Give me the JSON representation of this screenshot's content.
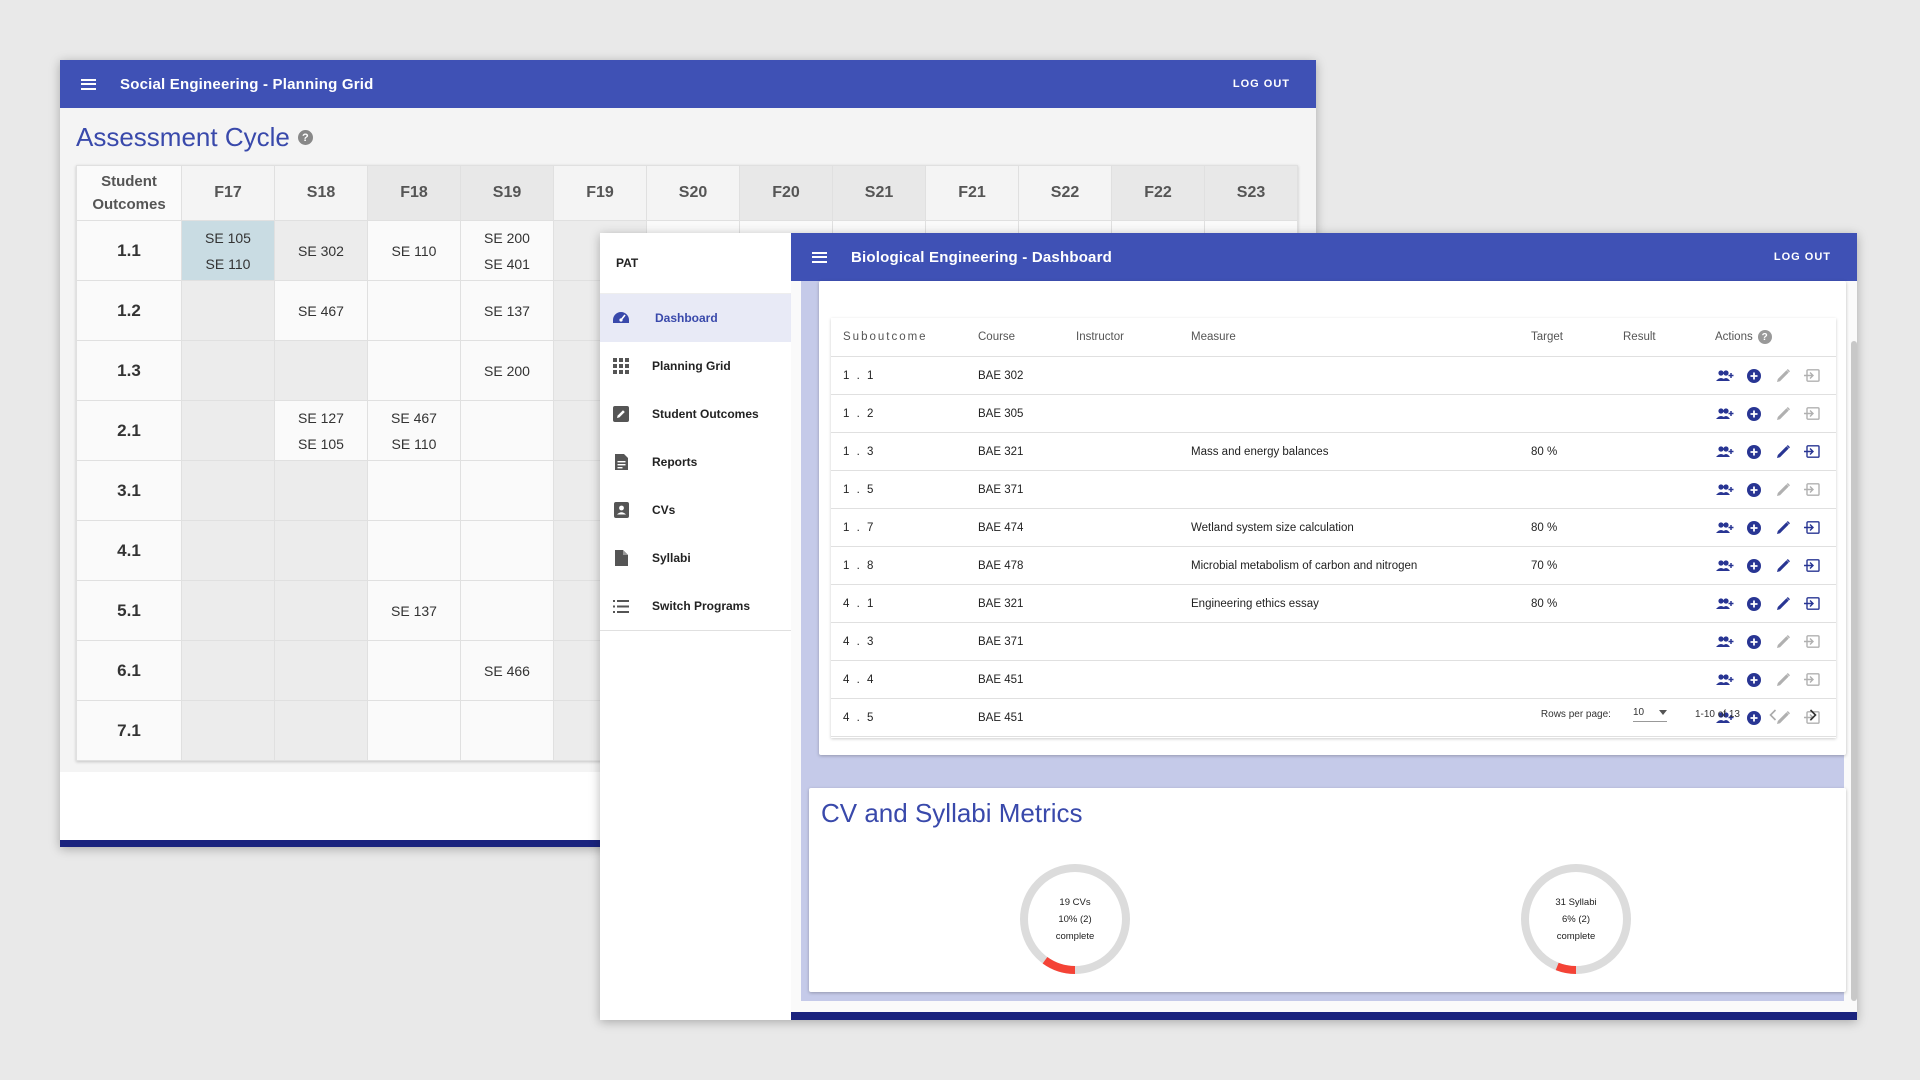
{
  "back_window": {
    "app_title": "Social Engineering - Planning Grid",
    "logout": "LOG OUT",
    "page_title": "Assessment Cycle",
    "help": "?",
    "grid": {
      "outcomes_header": [
        "Student",
        "Outcomes"
      ],
      "terms": [
        "F17",
        "S18",
        "F18",
        "S19",
        "F19",
        "S20",
        "F20",
        "S21",
        "F21",
        "S22",
        "F22",
        "S23"
      ],
      "rows": [
        {
          "outcome": "1.1",
          "cells": [
            [
              "SE 105",
              "SE 110"
            ],
            [
              "SE 302"
            ],
            [
              "SE 110"
            ],
            [
              "SE 200",
              "SE 401"
            ],
            [],
            [],
            [],
            [],
            [],
            [],
            [],
            []
          ]
        },
        {
          "outcome": "1.2",
          "cells": [
            [],
            [
              "SE 467"
            ],
            [],
            [
              "SE 137"
            ],
            [],
            [],
            [],
            [],
            [],
            [],
            [],
            []
          ]
        },
        {
          "outcome": "1.3",
          "cells": [
            [],
            [],
            [],
            [
              "SE 200"
            ],
            [],
            [],
            [],
            [],
            [],
            [],
            [],
            []
          ]
        },
        {
          "outcome": "2.1",
          "cells": [
            [],
            [
              "SE 127",
              "SE 105"
            ],
            [
              "SE 467",
              "SE 110"
            ],
            [],
            [],
            [],
            [],
            [],
            [],
            [],
            [],
            []
          ]
        },
        {
          "outcome": "3.1",
          "cells": [
            [],
            [],
            [],
            [],
            [],
            [],
            [],
            [],
            [],
            [],
            [],
            []
          ]
        },
        {
          "outcome": "4.1",
          "cells": [
            [],
            [],
            [],
            [],
            [],
            [],
            [],
            [],
            [],
            [],
            [],
            []
          ]
        },
        {
          "outcome": "5.1",
          "cells": [
            [],
            [],
            [
              "SE 137"
            ],
            [],
            [],
            [],
            [],
            [],
            [],
            [],
            [],
            []
          ]
        },
        {
          "outcome": "6.1",
          "cells": [
            [],
            [],
            [],
            [
              "SE 466"
            ],
            [],
            [],
            [],
            [],
            [],
            [],
            [],
            []
          ]
        },
        {
          "outcome": "7.1",
          "cells": [
            [],
            [],
            [],
            [],
            [],
            [],
            [],
            [],
            [],
            [],
            [],
            []
          ]
        }
      ]
    }
  },
  "front_window": {
    "drawer": {
      "brand": "PAT",
      "items": [
        {
          "label": "Dashboard",
          "icon": "dashboard-icon",
          "active": true
        },
        {
          "label": "Planning Grid",
          "icon": "grid-icon",
          "active": false
        },
        {
          "label": "Student Outcomes",
          "icon": "edit-box-icon",
          "active": false
        },
        {
          "label": "Reports",
          "icon": "document-icon",
          "active": false
        },
        {
          "label": "CVs",
          "icon": "contact-card-icon",
          "active": false
        },
        {
          "label": "Syllabi",
          "icon": "file-icon",
          "active": false
        },
        {
          "label": "Switch Programs",
          "icon": "list-icon",
          "active": false
        }
      ]
    },
    "app_title": "Biological Engineering - Dashboard",
    "logout": "LOG OUT",
    "table": {
      "headers": [
        "Suboutcome",
        "Course",
        "Instructor",
        "Measure",
        "Target",
        "Result",
        "Actions"
      ],
      "rows": [
        {
          "sub": "1 . 1",
          "course": "BAE 302",
          "instructor": "",
          "measure": "",
          "target": "",
          "result": "",
          "active": false
        },
        {
          "sub": "1 . 2",
          "course": "BAE 305",
          "instructor": "",
          "measure": "",
          "target": "",
          "result": "",
          "active": false
        },
        {
          "sub": "1 . 3",
          "course": "BAE 321",
          "instructor": "",
          "measure": "Mass and energy balances",
          "target": "80 %",
          "result": "",
          "active": true
        },
        {
          "sub": "1 . 5",
          "course": "BAE 371",
          "instructor": "",
          "measure": "",
          "target": "",
          "result": "",
          "active": false
        },
        {
          "sub": "1 . 7",
          "course": "BAE 474",
          "instructor": "",
          "measure": "Wetland system size calculation",
          "target": "80 %",
          "result": "",
          "active": true
        },
        {
          "sub": "1 . 8",
          "course": "BAE 478",
          "instructor": "",
          "measure": "Microbial metabolism of carbon and nitrogen",
          "target": "70 %",
          "result": "",
          "active": true
        },
        {
          "sub": "4 . 1",
          "course": "BAE 321",
          "instructor": "",
          "measure": "Engineering ethics essay",
          "target": "80 %",
          "result": "",
          "active": true
        },
        {
          "sub": "4 . 3",
          "course": "BAE 371",
          "instructor": "",
          "measure": "",
          "target": "",
          "result": "",
          "active": false
        },
        {
          "sub": "4 . 4",
          "course": "BAE 451",
          "instructor": "",
          "measure": "",
          "target": "",
          "result": "",
          "active": false
        },
        {
          "sub": "4 . 5",
          "course": "BAE 451",
          "instructor": "",
          "measure": "",
          "target": "",
          "result": "",
          "active": false
        }
      ],
      "pagination": {
        "rows_per_page_label": "Rows per page:",
        "rows_per_page": "10",
        "range": "1-10 of 13"
      }
    },
    "metrics": {
      "title": "CV and Syllabi Metrics",
      "donuts": [
        {
          "lines": [
            "19 CVs",
            "10% (2)",
            "complete"
          ],
          "fraction": 0.1
        },
        {
          "lines": [
            "31 Syllabi",
            "6% (2)",
            "complete"
          ],
          "fraction": 0.06
        }
      ]
    },
    "colors": {
      "primary": "#3f51b5",
      "dark": "#1a237e",
      "accent_red": "#f44336",
      "action_blue": "#283593",
      "disabled": "#b0b0b0"
    }
  }
}
